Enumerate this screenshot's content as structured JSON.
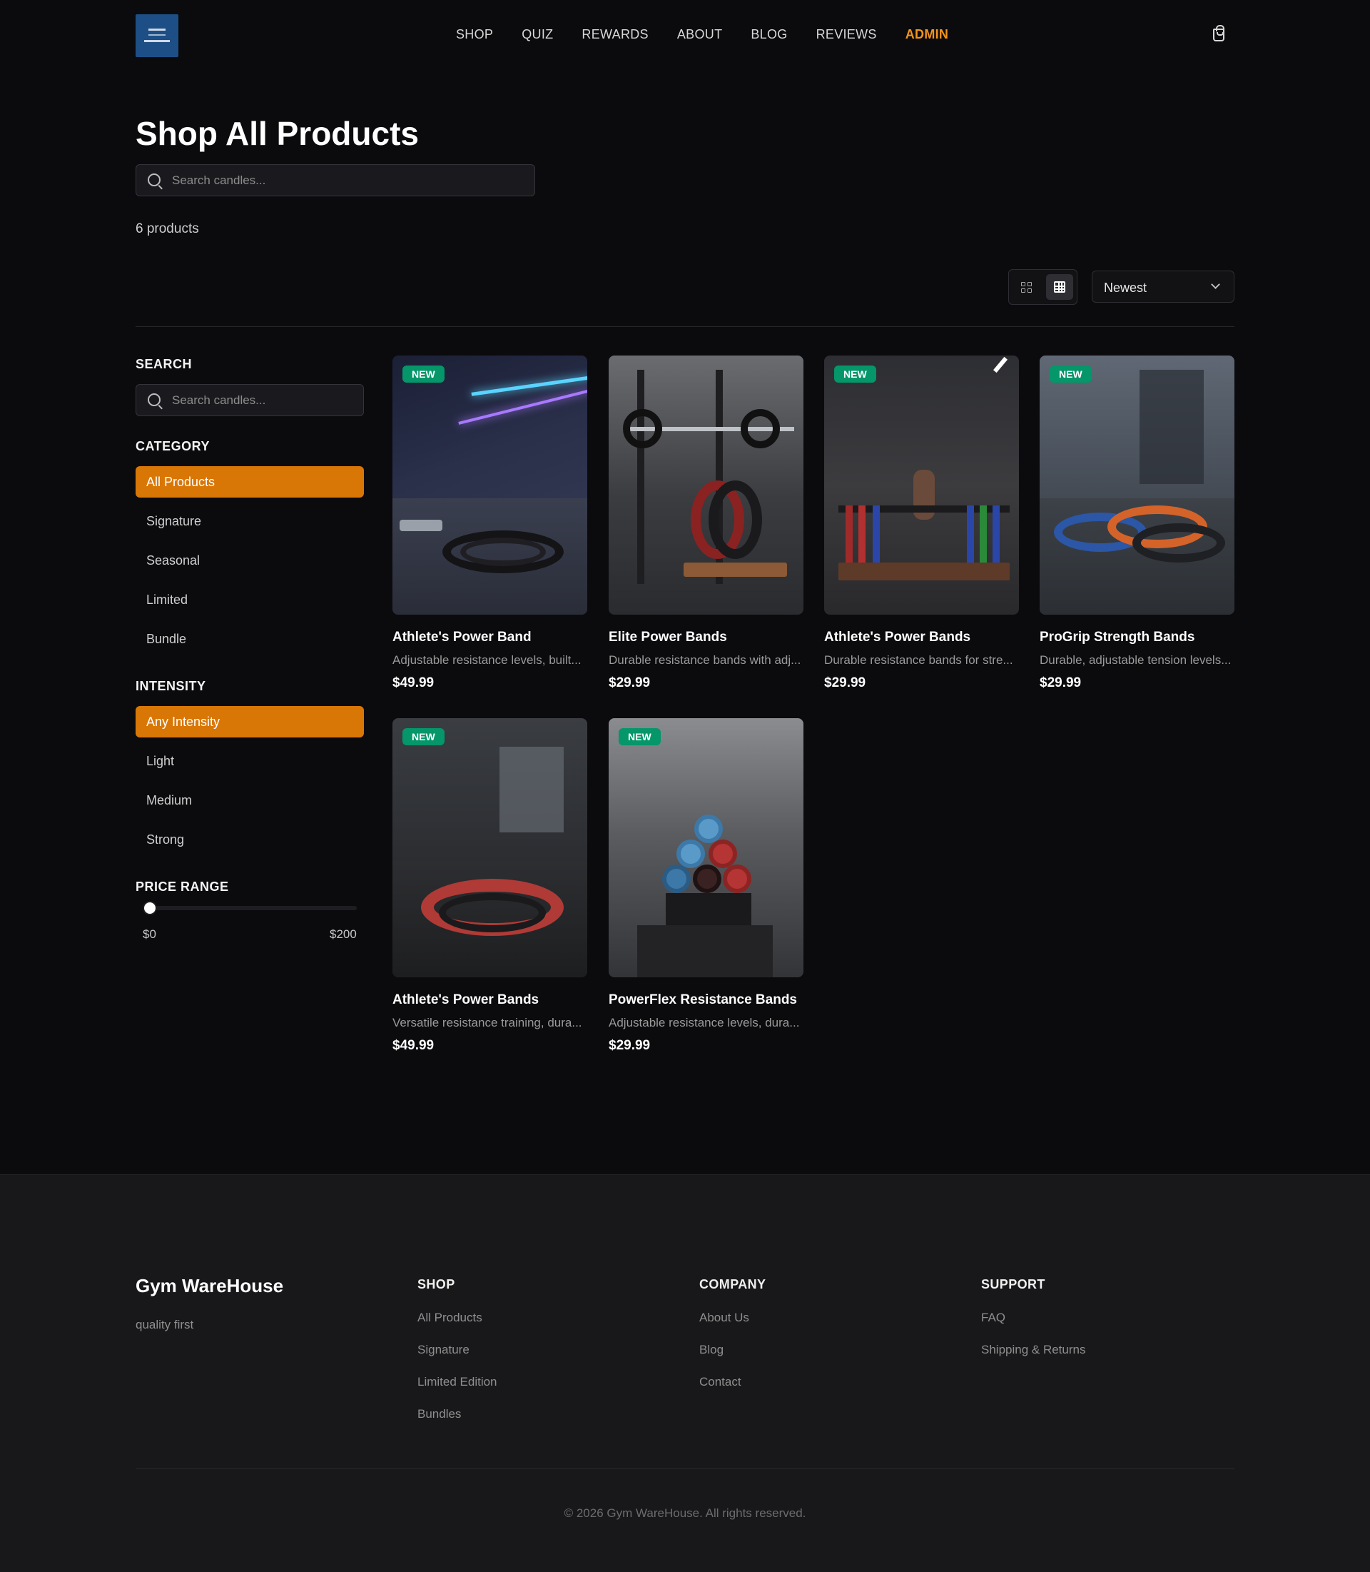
{
  "nav": {
    "links": [
      "SHOP",
      "QUIZ",
      "REWARDS",
      "ABOUT",
      "BLOG",
      "REVIEWS",
      "ADMIN"
    ]
  },
  "page": {
    "title": "Shop All Products",
    "search_placeholder": "Search candles...",
    "product_count": "6 products",
    "sort_value": "Newest"
  },
  "sidebar": {
    "search_heading": "SEARCH",
    "search_placeholder": "Search candles...",
    "category_heading": "CATEGORY",
    "categories": [
      "All Products",
      "Signature",
      "Seasonal",
      "Limited",
      "Bundle"
    ],
    "intensity_heading": "INTENSITY",
    "intensities": [
      "Any Intensity",
      "Light",
      "Medium",
      "Strong"
    ],
    "price_heading": "PRICE RANGE",
    "price_min": "$0",
    "price_max": "$200",
    "price_value_fraction": 0
  },
  "products": [
    {
      "badge": "NEW",
      "title": "Athlete's Power Band",
      "desc": "Adjustable resistance levels, built...",
      "price": "$49.99"
    },
    {
      "badge": "",
      "title": "Elite Power Bands",
      "desc": "Durable resistance bands with adj...",
      "price": "$29.99"
    },
    {
      "badge": "NEW",
      "title": "Athlete's Power Bands",
      "desc": "Durable resistance bands for stre...",
      "price": "$29.99"
    },
    {
      "badge": "NEW",
      "title": "ProGrip Strength Bands",
      "desc": "Durable, adjustable tension levels...",
      "price": "$29.99"
    },
    {
      "badge": "NEW",
      "title": "Athlete's Power Bands",
      "desc": "Versatile resistance training, dura...",
      "price": "$49.99"
    },
    {
      "badge": "NEW",
      "title": "PowerFlex Resistance Bands",
      "desc": "Adjustable resistance levels, dura...",
      "price": "$29.99"
    }
  ],
  "footer": {
    "brand": "Gym WareHouse",
    "tagline": "quality first",
    "shop_heading": "SHOP",
    "shop_links": [
      "All Products",
      "Signature",
      "Limited Edition",
      "Bundles"
    ],
    "company_heading": "COMPANY",
    "company_links": [
      "About Us",
      "Blog",
      "Contact"
    ],
    "support_heading": "SUPPORT",
    "support_links": [
      "FAQ",
      "Shipping & Returns"
    ],
    "copyright": "© 2026 Gym WareHouse. All rights reserved."
  },
  "colors": {
    "accent": "#d97706",
    "admin_link": "#f3941c",
    "badge": "#059669",
    "background": "#0b0b0e"
  }
}
